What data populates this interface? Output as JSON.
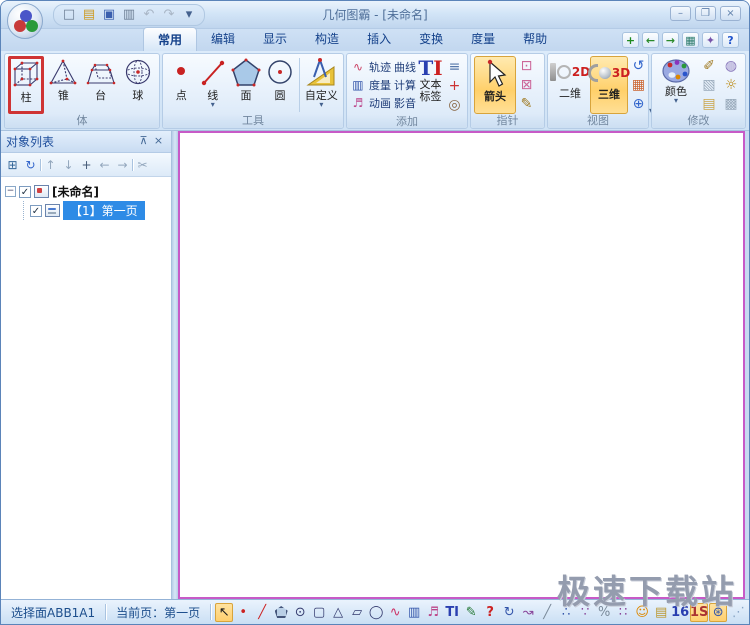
{
  "colors": {
    "accent_selection": "#ffd06a",
    "tree_selection": "#2e8be6",
    "canvas_border": "#c75ac7",
    "tool_highlight_red": "#cf3434",
    "ui_blue": "#c6daf1"
  },
  "window": {
    "title": "几何图霸 - [未命名]",
    "minimize": "–",
    "maximize": "❐",
    "close": "×"
  },
  "quick_access": [
    {
      "name": "new-file-button",
      "glyph": "□",
      "color": "#6d7f95"
    },
    {
      "name": "open-file-button",
      "glyph": "▤",
      "color": "#cc9a22"
    },
    {
      "name": "save-button",
      "glyph": "▣",
      "color": "#3a5fae"
    },
    {
      "name": "print-button",
      "glyph": "▥",
      "color": "#6d7f95"
    },
    {
      "name": "undo-button",
      "glyph": "↶",
      "color": "#a9b6c6"
    },
    {
      "name": "redo-button",
      "glyph": "↷",
      "color": "#a9b6c6"
    },
    {
      "name": "qat-customize-button",
      "glyph": "▾",
      "color": "#44618e"
    }
  ],
  "tabs": {
    "items": [
      {
        "name": "tab-common",
        "label": "常用",
        "active": true
      },
      {
        "name": "tab-edit",
        "label": "编辑"
      },
      {
        "name": "tab-display",
        "label": "显示"
      },
      {
        "name": "tab-construct",
        "label": "构造"
      },
      {
        "name": "tab-insert",
        "label": "插入"
      },
      {
        "name": "tab-transform",
        "label": "变换"
      },
      {
        "name": "tab-measure",
        "label": "度量"
      },
      {
        "name": "tab-help",
        "label": "帮助"
      }
    ]
  },
  "tabrow_right": [
    {
      "name": "add-page-button",
      "glyph": "+",
      "color": "#1f8a1f"
    },
    {
      "name": "prev-page-button",
      "glyph": "←",
      "color": "#2a8a2a"
    },
    {
      "name": "next-page-button",
      "glyph": "→",
      "color": "#2a8a2a"
    },
    {
      "name": "page-manager-button",
      "glyph": "▦",
      "color": "#2a7a6a"
    },
    {
      "name": "skin-button",
      "glyph": "✦",
      "color": "#7755aa"
    },
    {
      "name": "help-button",
      "glyph": "?",
      "color": "#2255cc"
    }
  ],
  "ribbon": {
    "solids": {
      "label": "体",
      "buttons": [
        {
          "label": "柱"
        },
        {
          "label": "锥"
        },
        {
          "label": "台"
        },
        {
          "label": "球"
        }
      ]
    },
    "tools": {
      "label": "工具",
      "point": "点",
      "line": "线",
      "face": "面",
      "circle": "圆",
      "custom": "自定义"
    },
    "add": {
      "label": "添加",
      "rows": [
        {
          "glyph": "∿",
          "items": [
            "轨迹",
            "曲线"
          ]
        },
        {
          "glyph": "▥",
          "items": [
            "度量",
            "计算"
          ]
        },
        {
          "glyph": "♬",
          "items": [
            "动画",
            "影音"
          ]
        }
      ],
      "ti_t": "T",
      "ti_i": "I",
      "text_line1": "文本",
      "text_line2": "标签",
      "side_icons": [
        {
          "name": "formula-list-icon",
          "glyph": "≡",
          "color": "#5577aa"
        },
        {
          "name": "coordinate-system-icon",
          "glyph": "+",
          "color": "#cc3333"
        },
        {
          "name": "conic-icon",
          "glyph": "◎",
          "color": "#886644"
        }
      ]
    },
    "pointer": {
      "label": "指针",
      "arrow": "箭头",
      "side_icons": [
        {
          "name": "select-region-icon",
          "glyph": "⊡",
          "color": "#cc6699"
        },
        {
          "name": "lock-select-icon",
          "glyph": "⊠",
          "color": "#cc6699"
        },
        {
          "name": "pen-icon",
          "glyph": "✎",
          "color": "#a07a22"
        }
      ]
    },
    "view": {
      "label": "视图",
      "d2": "二维",
      "d2_mark": "2D",
      "d3": "三维",
      "d3_mark": "3D",
      "side_icons": [
        {
          "name": "rotate-view-icon",
          "glyph": "↺",
          "color": "#3366cc"
        },
        {
          "name": "grid-icon",
          "glyph": "▦",
          "color": "#cc6633"
        },
        {
          "name": "axes-icon",
          "glyph": "⊕",
          "color": "#3366cc"
        }
      ]
    },
    "modify": {
      "label": "修改",
      "color": "颜色",
      "side_icons": [
        {
          "name": "brush-icon",
          "glyph": "✐",
          "color": "#a07a22"
        },
        {
          "name": "material-icon",
          "glyph": "◍",
          "color": "#8877bb"
        },
        {
          "name": "image-fill-icon",
          "glyph": "▧",
          "color": "#99aabb"
        },
        {
          "name": "settings-gear-icon",
          "glyph": "☼",
          "color": "#b8860b"
        },
        {
          "name": "export-icon",
          "glyph": "▤",
          "color": "#caa54a"
        },
        {
          "name": "raster-icon",
          "glyph": "▩",
          "color": "#99aabb"
        }
      ]
    }
  },
  "panel": {
    "title": "对象列表",
    "pin": "⊼",
    "close": "×",
    "toolbar": [
      {
        "name": "expand-tree-button",
        "glyph": "⊞",
        "color": "#336699"
      },
      {
        "name": "locate-object-button",
        "glyph": "↻",
        "color": "#3366cc"
      },
      {
        "sep": true
      },
      {
        "name": "move-up-button",
        "glyph": "↑",
        "color": "#93a7bd"
      },
      {
        "name": "move-down-button",
        "glyph": "↓",
        "color": "#93a7bd"
      },
      {
        "name": "add-object-button",
        "glyph": "+",
        "color": "#445a77"
      },
      {
        "name": "move-left-button",
        "glyph": "←",
        "color": "#93a7bd"
      },
      {
        "name": "move-right-button",
        "glyph": "→",
        "color": "#93a7bd"
      },
      {
        "sep": true
      },
      {
        "name": "cut-object-button",
        "glyph": "✂",
        "color": "#93a7bd"
      }
    ],
    "tree": {
      "expander": "−",
      "check": "✓",
      "root_label": "[未命名]",
      "page_label": "【1】第一页"
    }
  },
  "statusbar": {
    "selection": "选择面ABB1A1",
    "current_page": "当前页：第一页",
    "grip": "⋰"
  },
  "bottom_toolbar": [
    {
      "name": "arrow-tool",
      "glyph": "↖",
      "color": "#1a1a1a",
      "selected": true
    },
    {
      "name": "point-tool",
      "glyph": "•",
      "color": "#cc2222"
    },
    {
      "name": "line-tool",
      "glyph": "╱",
      "color": "#cc2222"
    },
    {
      "name": "face-tool",
      "shape": "pentagon"
    },
    {
      "name": "circle-tool",
      "glyph": "⊙",
      "color": "#333a6e"
    },
    {
      "name": "prism-tool",
      "glyph": "▢",
      "color": "#333a6e"
    },
    {
      "name": "pyramid-tool",
      "glyph": "△",
      "color": "#333a6e"
    },
    {
      "name": "frustum-tool",
      "glyph": "▱",
      "color": "#333a6e"
    },
    {
      "name": "sphere-tool",
      "glyph": "◯",
      "color": "#333a6e"
    },
    {
      "name": "locus-tool",
      "glyph": "∿",
      "color": "#cc3366"
    },
    {
      "name": "measure-tool",
      "glyph": "▥",
      "color": "#3355aa"
    },
    {
      "name": "animation-tool",
      "glyph": "♬",
      "color": "#bb4488"
    },
    {
      "name": "text-label-tool",
      "glyph": "TI",
      "color": "#2a3fb0",
      "small_text": true
    },
    {
      "name": "calculate-tool",
      "glyph": "✎",
      "color": "#227733"
    },
    {
      "name": "measure-value-tool",
      "glyph": "?",
      "color": "#cc2222",
      "small_text": true
    },
    {
      "name": "rotate-animation-tool",
      "glyph": "↻",
      "color": "#3355aa"
    },
    {
      "name": "drag-point-tool",
      "glyph": "↝",
      "color": "#884499"
    },
    {
      "name": "parallel-line-tool",
      "glyph": "╱",
      "color": "#7a8a9a"
    },
    {
      "name": "point-set-tool",
      "glyph": "∴",
      "color": "#3355aa"
    },
    {
      "name": "scatter-tool",
      "glyph": "∵",
      "color": "#884499"
    },
    {
      "name": "ratio-tool",
      "glyph": "%",
      "color": "#7a8a9a"
    },
    {
      "name": "divide-tool",
      "glyph": "∷",
      "color": "#884499"
    },
    {
      "name": "smiley-tool",
      "glyph": "☺",
      "color": "#dd8800"
    },
    {
      "name": "folder-tool",
      "glyph": "▤",
      "color": "#bb9933"
    },
    {
      "name": "page-number-tool",
      "glyph": "16",
      "color": "#2a3fb0",
      "small_text": true
    },
    {
      "name": "page-style-tool",
      "glyph": "1S",
      "color": "#aa3333",
      "small_text": true,
      "selected": true
    },
    {
      "name": "globe-tool",
      "glyph": "⊛",
      "color": "#3355aa",
      "selected": true
    }
  ],
  "watermark": {
    "text": "极速下载站"
  }
}
